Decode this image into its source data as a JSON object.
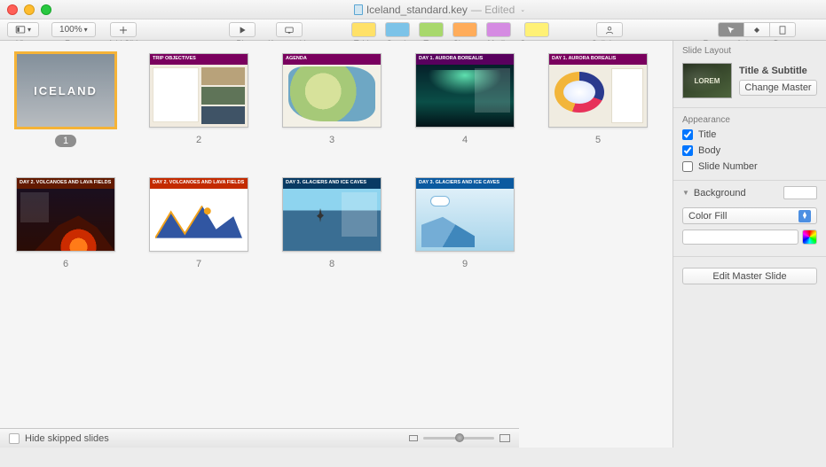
{
  "window": {
    "filename": "Iceland_standard.key",
    "edited": "— Edited"
  },
  "toolbar": {
    "view": "View",
    "zoom": "Zoom",
    "zoomValue": "100%",
    "addSlide": "Add Slide",
    "play": "Play",
    "keynoteLive": "Keynote Live",
    "table": "Table",
    "graph": "Graph",
    "text": "Text",
    "shape": "Shape",
    "media": "Media",
    "comment": "Comment",
    "collaborate": "Collaborate",
    "format": "Format",
    "animate": "Animate",
    "document": "Document"
  },
  "slides": {
    "s1": {
      "title": "ICELAND",
      "num": "1"
    },
    "s2": {
      "bar": "TRIP OBJECTIVES",
      "num": "2"
    },
    "s3": {
      "bar": "AGENDA",
      "num": "3"
    },
    "s4": {
      "bar": "DAY 1. AURORA BOREALIS",
      "num": "4"
    },
    "s5": {
      "bar": "DAY 1. AURORA BOREALIS",
      "num": "5"
    },
    "s6": {
      "bar": "DAY 2. VOLCANOES AND LAVA FIELDS",
      "num": "6"
    },
    "s7": {
      "bar": "DAY 2. VOLCANOES AND LAVA FIELDS",
      "num": "7"
    },
    "s8": {
      "bar": "DAY 3. GLACIERS AND ICE CAVES",
      "num": "8"
    },
    "s9": {
      "bar": "DAY 3. GLACIERS AND ICE CAVES",
      "num": "9"
    }
  },
  "footer": {
    "hideSkipped": "Hide skipped slides"
  },
  "sidebar": {
    "layoutTitle": "Slide Layout",
    "masterPreview": "LOREM",
    "layoutName": "Title & Subtitle",
    "changeMaster": "Change Master",
    "appearance": "Appearance",
    "title": "Title",
    "body": "Body",
    "slideNumber": "Slide Number",
    "background": "Background",
    "fillType": "Color Fill",
    "editMaster": "Edit Master Slide"
  }
}
